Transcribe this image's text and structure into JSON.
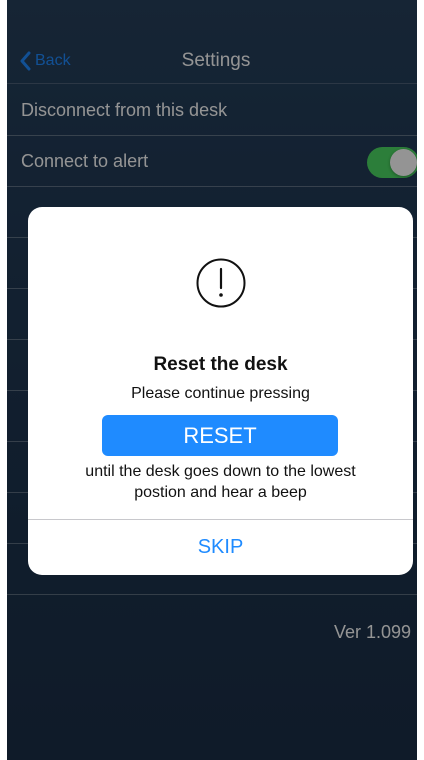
{
  "nav": {
    "back_label": "Back",
    "title": "Settings"
  },
  "settings": {
    "items": [
      {
        "label": "Disconnect from this desk"
      },
      {
        "label": "Connect to alert",
        "toggle": true,
        "toggle_on": true
      },
      {
        "label": ""
      },
      {
        "label": ""
      },
      {
        "label": ""
      },
      {
        "label": ""
      },
      {
        "label": ""
      },
      {
        "label": ""
      },
      {
        "label": ""
      },
      {
        "label": ""
      }
    ]
  },
  "version": "Ver 1.099",
  "dialog": {
    "icon": "exclamation-circle-icon",
    "title": "Reset the desk",
    "message": "Please continue pressing",
    "reset_label": "RESET",
    "instructions": "until the desk goes down to the lowest postion and hear a beep",
    "skip_label": "SKIP"
  },
  "colors": {
    "accent": "#1f8bff",
    "toggle_on": "#4cd964",
    "background": "#21395a"
  }
}
